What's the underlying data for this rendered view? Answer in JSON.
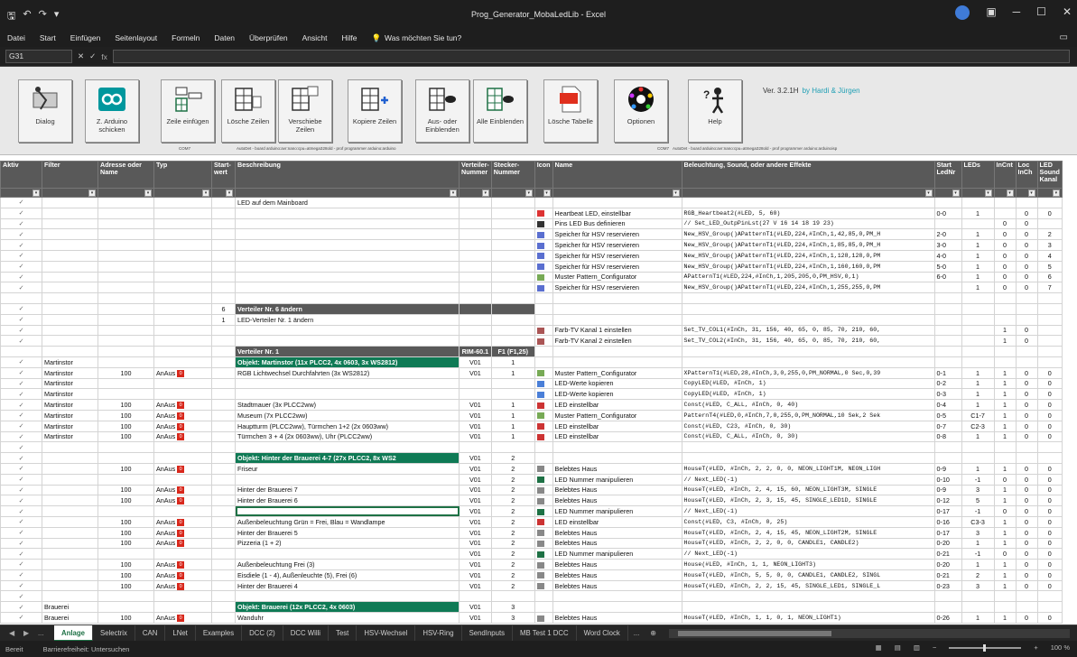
{
  "window": {
    "title": "Prog_Generator_MobaLedLib - Excel",
    "minimize": "─",
    "maximize": "☐",
    "close": "✕"
  },
  "ribbon_tabs": [
    "Datei",
    "Start",
    "Einfügen",
    "Seitenlayout",
    "Formeln",
    "Daten",
    "Überprüfen",
    "Ansicht",
    "Hilfe"
  ],
  "tell_me": "Was möchten Sie tun?",
  "formula_bar": {
    "name_box": "G31",
    "fx": "fx"
  },
  "macro_buttons": [
    {
      "label": "Dialog",
      "icon": "dialog-icon"
    },
    {
      "label": "Z. Arduino schicken",
      "icon": "arduino-icon"
    },
    {
      "label": "Zeile einfügen",
      "icon": "insert-row-icon"
    },
    {
      "label": "Lösche Zeilen",
      "icon": "delete-rows-icon"
    },
    {
      "label": "Verschiebe Zeilen",
      "icon": "move-rows-icon"
    },
    {
      "label": "Kopiere Zeilen",
      "icon": "copy-rows-icon"
    },
    {
      "label": "Aus- oder Einblenden",
      "icon": "hide-show-icon"
    },
    {
      "label": "Alle Einblenden",
      "icon": "show-all-icon"
    },
    {
      "label": "Lösche Tabelle",
      "icon": "delete-table-icon"
    },
    {
      "label": "Optionen",
      "icon": "options-icon"
    },
    {
      "label": "Help",
      "icon": "help-icon"
    }
  ],
  "version": {
    "text": "Ver. 3.2.1H",
    "by": "by Hardi & Jürgen"
  },
  "notes": {
    "com_left": "COM7",
    "com_left_desc": "AutoDet - board arduino:avr:nano:cpu=atmega328old - prof programmer arduino:arduino",
    "com_right": "COM7",
    "com_right_desc": "AutoDet - board arduino:avr:nano:cpu=atmega328old - prof programmer arduino:arduinoisp"
  },
  "columns": [
    "Aktiv",
    "Filter",
    "Adresse oder Name",
    "Typ",
    "Start-wert",
    "Beschreibung",
    "Verteiler-Nummer",
    "Stecker-Nummer",
    "Icon",
    "Name",
    "Beleuchtung, Sound, oder andere Effekte",
    "Start LedNr",
    "LEDs",
    "InCnt",
    "Loc InCh",
    "LED Sound Kanal"
  ],
  "rows": [
    {
      "a": "✓",
      "f": "",
      "adr": "",
      "typ": "",
      "sw": "",
      "desc": "LED auf dem Mainboard",
      "vn": "",
      "sn": "",
      "icon": "",
      "name": "",
      "eff": "",
      "led": "",
      "leds": "",
      "inc": "",
      "loc": "",
      "snd": ""
    },
    {
      "a": "✓",
      "f": "",
      "adr": "",
      "typ": "",
      "sw": "",
      "desc": "",
      "vn": "",
      "sn": "",
      "icon": "heart",
      "name": "Heartbeat LED, einstellbar",
      "eff": "RGB_Heartbeat2(#LED, 5, 60)",
      "led": "0-0",
      "leds": "1",
      "inc": "",
      "loc": "0",
      "snd": "0"
    },
    {
      "a": "✓",
      "f": "",
      "adr": "",
      "typ": "",
      "sw": "",
      "desc": "",
      "vn": "",
      "sn": "",
      "icon": "pin",
      "name": "Pins LED Bus definieren",
      "eff": "// Set_LED_OutpPinLst(27 V 16 14 18 19 23)",
      "led": "",
      "leds": "",
      "inc": "0",
      "loc": "0",
      "snd": ""
    },
    {
      "a": "✓",
      "f": "",
      "adr": "",
      "typ": "",
      "sw": "",
      "desc": "",
      "vn": "",
      "sn": "",
      "icon": "mem",
      "name": "Speicher für HSV reservieren",
      "eff": "New_HSV_Group()APatternT1(#LED,224,#InCh,1,42,85,0,PM_H",
      "led": "2-0",
      "leds": "1",
      "inc": "0",
      "loc": "0",
      "snd": "2"
    },
    {
      "a": "✓",
      "f": "",
      "adr": "",
      "typ": "",
      "sw": "",
      "desc": "",
      "vn": "",
      "sn": "",
      "icon": "mem",
      "name": "Speicher für HSV reservieren",
      "eff": "New_HSV_Group()APatternT1(#LED,224,#InCh,1,85,85,0,PM_H",
      "led": "3-0",
      "leds": "1",
      "inc": "0",
      "loc": "0",
      "snd": "3"
    },
    {
      "a": "✓",
      "f": "",
      "adr": "",
      "typ": "",
      "sw": "",
      "desc": "",
      "vn": "",
      "sn": "",
      "icon": "mem",
      "name": "Speicher für HSV reservieren",
      "eff": "New_HSV_Group()APatternT1(#LED,224,#InCh,1,128,128,0,PM",
      "led": "4-0",
      "leds": "1",
      "inc": "0",
      "loc": "0",
      "snd": "4"
    },
    {
      "a": "✓",
      "f": "",
      "adr": "",
      "typ": "",
      "sw": "",
      "desc": "",
      "vn": "",
      "sn": "",
      "icon": "mem",
      "name": "Speicher für HSV reservieren",
      "eff": "New_HSV_Group()APatternT1(#LED,224,#InCh,1,160,160,0,PM",
      "led": "5-0",
      "leds": "1",
      "inc": "0",
      "loc": "0",
      "snd": "5"
    },
    {
      "a": "✓",
      "f": "",
      "adr": "",
      "typ": "",
      "sw": "",
      "desc": "",
      "vn": "",
      "sn": "",
      "icon": "pat",
      "name": "Muster Pattern_Configurator",
      "eff": "APatternT1(#LED,224,#InCh,1,205,205,0,PM_HSV,0,1)",
      "led": "6-0",
      "leds": "1",
      "inc": "0",
      "loc": "0",
      "snd": "6"
    },
    {
      "a": "✓",
      "f": "",
      "adr": "",
      "typ": "",
      "sw": "",
      "desc": "",
      "vn": "",
      "sn": "",
      "icon": "mem",
      "name": "Speicher für HSV reservieren",
      "eff": "New_HSV_Group()APatternT1(#LED,224,#InCh,1,255,255,0,PM",
      "led": "",
      "leds": "1",
      "inc": "0",
      "loc": "0",
      "snd": "7"
    },
    {
      "a": "",
      "f": "",
      "adr": "",
      "typ": "",
      "sw": "",
      "desc": "",
      "vn": "",
      "sn": "",
      "icon": "",
      "name": "",
      "eff": "",
      "led": "",
      "leds": "",
      "inc": "",
      "loc": "",
      "snd": ""
    },
    {
      "a": "✓",
      "f": "",
      "adr": "",
      "typ": "",
      "sw": "6",
      "desc": "Verteiler Nr. 6 ändern",
      "vn": "",
      "sn": "",
      "icon": "",
      "name": "",
      "eff": "",
      "led": "",
      "leds": "",
      "inc": "",
      "loc": "",
      "snd": "",
      "kind": "verteiler"
    },
    {
      "a": "✓",
      "f": "",
      "adr": "",
      "typ": "",
      "sw": "1",
      "desc": "LED-Verteiler Nr. 1 ändern",
      "vn": "",
      "sn": "",
      "icon": "",
      "name": "",
      "eff": "",
      "led": "",
      "leds": "",
      "inc": "",
      "loc": "",
      "snd": ""
    },
    {
      "a": "✓",
      "f": "",
      "adr": "",
      "typ": "",
      "sw": "",
      "desc": "",
      "vn": "",
      "sn": "",
      "icon": "tv",
      "name": "Farb-TV Kanal 1 einstellen",
      "eff": "Set_TV_COL1(#InCh, 31, 156, 40, 65, 0, 85, 70, 210, 60,",
      "led": "",
      "leds": "",
      "inc": "1",
      "loc": "0",
      "snd": ""
    },
    {
      "a": "✓",
      "f": "",
      "adr": "",
      "typ": "",
      "sw": "",
      "desc": "",
      "vn": "",
      "sn": "",
      "icon": "tv",
      "name": "Farb-TV Kanal 2 einstellen",
      "eff": "Set_TV_COL2(#InCh, 31, 156, 40, 65, 0, 85, 70, 210, 60,",
      "led": "",
      "leds": "",
      "inc": "1",
      "loc": "0",
      "snd": ""
    },
    {
      "a": "",
      "f": "",
      "adr": "",
      "typ": "",
      "sw": "",
      "desc": "Verteiler Nr. 1",
      "vn": "RIM-60.1",
      "sn": "F1 (F1,25)",
      "icon": "",
      "name": "",
      "eff": "",
      "led": "",
      "leds": "",
      "inc": "",
      "loc": "",
      "snd": "",
      "kind": "verteiler"
    },
    {
      "a": "✓",
      "f": "Martinstor",
      "adr": "",
      "typ": "",
      "sw": "",
      "desc": "Objekt: Martinstor (11x PLCC2, 4x 0603, 3x WS2812)",
      "vn": "V01",
      "sn": "1",
      "icon": "",
      "name": "",
      "eff": "",
      "led": "",
      "leds": "",
      "inc": "",
      "loc": "",
      "snd": "",
      "kind": "objekt"
    },
    {
      "a": "✓",
      "f": "Martinstor",
      "adr": "100",
      "typ": "AnAus",
      "sw": "",
      "desc": "RGB Lichtwechsel Durchfahrten (3x WS2812)",
      "vn": "V01",
      "sn": "1",
      "icon": "pat",
      "name": "Muster Pattern_Configurator",
      "eff": "XPatternT1(#LED,28,#InCh,3,0,255,0,PM_NORMAL,0 Sec,0,39",
      "led": "0-1",
      "leds": "1",
      "inc": "1",
      "loc": "0",
      "snd": "0"
    },
    {
      "a": "✓",
      "f": "Martinstor",
      "adr": "",
      "typ": "",
      "sw": "",
      "desc": "",
      "vn": "",
      "sn": "",
      "icon": "copy",
      "name": "LED-Werte kopieren",
      "eff": "CopyLED(#LED, #InCh, 1)",
      "led": "0-2",
      "leds": "1",
      "inc": "1",
      "loc": "0",
      "snd": "0"
    },
    {
      "a": "✓",
      "f": "Martinstor",
      "adr": "",
      "typ": "",
      "sw": "",
      "desc": "",
      "vn": "",
      "sn": "",
      "icon": "copy",
      "name": "LED-Werte kopieren",
      "eff": "CopyLED(#LED, #InCh, 1)",
      "led": "0-3",
      "leds": "1",
      "inc": "1",
      "loc": "0",
      "snd": "0"
    },
    {
      "a": "✓",
      "f": "Martinstor",
      "adr": "100",
      "typ": "AnAus",
      "sw": "",
      "desc": "Stadtmauer (3x PLCC2ww)",
      "vn": "V01",
      "sn": "1",
      "icon": "led",
      "name": "LED einstellbar",
      "eff": "Const(#LED, C_ALL, #InCh, 0, 40)",
      "led": "0-4",
      "leds": "1",
      "inc": "1",
      "loc": "0",
      "snd": "0"
    },
    {
      "a": "✓",
      "f": "Martinstor",
      "adr": "100",
      "typ": "AnAus",
      "sw": "",
      "desc": "Museum (7x PLCC2ww)",
      "vn": "V01",
      "sn": "1",
      "icon": "pat",
      "name": "Muster Pattern_Configurator",
      "eff": "PatternT4(#LED,0,#InCh,7,0,255,0,PM_NORMAL,10 Sek,2 Sek",
      "led": "0-5",
      "leds": "C1-7",
      "inc": "1",
      "loc": "0",
      "snd": "0"
    },
    {
      "a": "✓",
      "f": "Martinstor",
      "adr": "100",
      "typ": "AnAus",
      "sw": "",
      "desc": "Hauptturm (PLCC2ww), Türmchen 1+2 (2x 0603ww)",
      "vn": "V01",
      "sn": "1",
      "icon": "led",
      "name": "LED einstellbar",
      "eff": "Const(#LED, C23, #InCh, 0, 30)",
      "led": "0-7",
      "leds": "C2-3",
      "inc": "1",
      "loc": "0",
      "snd": "0"
    },
    {
      "a": "✓",
      "f": "Martinstor",
      "adr": "100",
      "typ": "AnAus",
      "sw": "",
      "desc": "Türmchen 3 + 4 (2x 0603ww), Uhr (PLCC2ww)",
      "vn": "V01",
      "sn": "1",
      "icon": "led",
      "name": "LED einstellbar",
      "eff": "Const(#LED, C_ALL, #InCh, 0, 30)",
      "led": "0-8",
      "leds": "1",
      "inc": "1",
      "loc": "0",
      "snd": "0"
    },
    {
      "a": "✓",
      "f": "",
      "adr": "",
      "typ": "",
      "sw": "",
      "desc": "",
      "vn": "",
      "sn": "",
      "icon": "",
      "name": "",
      "eff": "",
      "led": "",
      "leds": "",
      "inc": "",
      "loc": "",
      "snd": ""
    },
    {
      "a": "✓",
      "f": "",
      "adr": "",
      "typ": "",
      "sw": "",
      "desc": "Objekt: Hinter der Brauerei 4-7 (27x PLCC2, 8x WS2",
      "vn": "V01",
      "sn": "2",
      "icon": "",
      "name": "",
      "eff": "",
      "led": "",
      "leds": "",
      "inc": "",
      "loc": "",
      "snd": "",
      "kind": "objekt"
    },
    {
      "a": "✓",
      "f": "",
      "adr": "100",
      "typ": "AnAus",
      "sw": "",
      "desc": "Friseur",
      "vn": "V01",
      "sn": "2",
      "icon": "house",
      "name": "Belebtes Haus",
      "eff": "HouseT(#LED, #InCh, 2, 2, 0, 0, NEON_LIGHT1M, NEON_LIGH",
      "led": "0-9",
      "leds": "1",
      "inc": "1",
      "loc": "0",
      "snd": "0"
    },
    {
      "a": "✓",
      "f": "",
      "adr": "",
      "typ": "",
      "sw": "",
      "desc": "",
      "vn": "V01",
      "sn": "2",
      "icon": "num",
      "name": "LED Nummer manipulieren",
      "eff": "// Next_LED(-1)",
      "led": "0-10",
      "leds": "-1",
      "inc": "0",
      "loc": "0",
      "snd": "0"
    },
    {
      "a": "✓",
      "f": "",
      "adr": "100",
      "typ": "AnAus",
      "sw": "",
      "desc": "Hinter der Brauerei 7",
      "vn": "V01",
      "sn": "2",
      "icon": "house",
      "name": "Belebtes Haus",
      "eff": "HouseT(#LED, #InCh, 2, 4, 15, 60, NEON_LIGHT3M, SINGLE",
      "led": "0-9",
      "leds": "3",
      "inc": "1",
      "loc": "0",
      "snd": "0"
    },
    {
      "a": "✓",
      "f": "",
      "adr": "100",
      "typ": "AnAus",
      "sw": "",
      "desc": "Hinter der Brauerei 6",
      "vn": "V01",
      "sn": "2",
      "icon": "house",
      "name": "Belebtes Haus",
      "eff": "HouseT(#LED, #InCh, 2, 3, 15, 45, SINGLE_LED1D, SINGLE",
      "led": "0-12",
      "leds": "5",
      "inc": "1",
      "loc": "0",
      "snd": "0"
    },
    {
      "a": "✓",
      "f": "",
      "adr": "",
      "typ": "",
      "sw": "",
      "desc": "",
      "vn": "V01",
      "sn": "2",
      "icon": "num",
      "name": "LED Nummer manipulieren",
      "eff": "// Next_LED(-1)",
      "led": "0-17",
      "leds": "-1",
      "inc": "0",
      "loc": "0",
      "snd": "0",
      "kind": "selected"
    },
    {
      "a": "✓",
      "f": "",
      "adr": "100",
      "typ": "AnAus",
      "sw": "",
      "desc": "Außenbeleuchtung Grün = Frei, Blau = Wandlampe",
      "vn": "V01",
      "sn": "2",
      "icon": "led",
      "name": "LED einstellbar",
      "eff": "Const(#LED, C3, #InCh, 0, 25)",
      "led": "0-16",
      "leds": "C3-3",
      "inc": "1",
      "loc": "0",
      "snd": "0"
    },
    {
      "a": "✓",
      "f": "",
      "adr": "100",
      "typ": "AnAus",
      "sw": "",
      "desc": "Hinter der Brauerei 5",
      "vn": "V01",
      "sn": "2",
      "icon": "house",
      "name": "Belebtes Haus",
      "eff": "HouseT(#LED, #InCh, 2, 4, 15, 45, NEON_LIGHT2M, SINGLE",
      "led": "0-17",
      "leds": "3",
      "inc": "1",
      "loc": "0",
      "snd": "0"
    },
    {
      "a": "✓",
      "f": "",
      "adr": "100",
      "typ": "AnAus",
      "sw": "",
      "desc": "Pizzeria (1 + 2)",
      "vn": "V01",
      "sn": "2",
      "icon": "house",
      "name": "Belebtes Haus",
      "eff": "HouseT(#LED, #InCh, 2, 2, 0, 0, CANDLE1, CANDLE2)",
      "led": "0-20",
      "leds": "1",
      "inc": "1",
      "loc": "0",
      "snd": "0"
    },
    {
      "a": "✓",
      "f": "",
      "adr": "",
      "typ": "",
      "sw": "",
      "desc": "",
      "vn": "V01",
      "sn": "2",
      "icon": "num",
      "name": "LED Nummer manipulieren",
      "eff": "// Next_LED(-1)",
      "led": "0-21",
      "leds": "-1",
      "inc": "0",
      "loc": "0",
      "snd": "0"
    },
    {
      "a": "✓",
      "f": "",
      "adr": "100",
      "typ": "AnAus",
      "sw": "",
      "desc": "Außenbeleuchtung Frei (3)",
      "vn": "V01",
      "sn": "2",
      "icon": "house",
      "name": "Belebtes Haus",
      "eff": "House(#LED, #InCh, 1, 1, NEON_LIGHT3)",
      "led": "0-20",
      "leds": "1",
      "inc": "1",
      "loc": "0",
      "snd": "0"
    },
    {
      "a": "✓",
      "f": "",
      "adr": "100",
      "typ": "AnAus",
      "sw": "",
      "desc": "Eisdiele (1 - 4), Außenleuchte (5), Frei (6)",
      "vn": "V01",
      "sn": "2",
      "icon": "house",
      "name": "Belebtes Haus",
      "eff": "HouseT(#LED, #InCh, 5, 5, 0, 0, CANDLE1, CANDLE2, SINGL",
      "led": "0-21",
      "leds": "2",
      "inc": "1",
      "loc": "0",
      "snd": "0"
    },
    {
      "a": "✓",
      "f": "",
      "adr": "100",
      "typ": "AnAus",
      "sw": "",
      "desc": "Hinter der Brauerei 4",
      "vn": "V01",
      "sn": "2",
      "icon": "house",
      "name": "Belebtes Haus",
      "eff": "HouseT(#LED, #InCh, 2, 2, 15, 45, SINGLE_LED1, SINGLE_L",
      "led": "0-23",
      "leds": "3",
      "inc": "1",
      "loc": "0",
      "snd": "0"
    },
    {
      "a": "✓",
      "f": "",
      "adr": "",
      "typ": "",
      "sw": "",
      "desc": "",
      "vn": "",
      "sn": "",
      "icon": "",
      "name": "",
      "eff": "",
      "led": "",
      "leds": "",
      "inc": "",
      "loc": "",
      "snd": ""
    },
    {
      "a": "✓",
      "f": "Brauerei",
      "adr": "",
      "typ": "",
      "sw": "",
      "desc": "Objekt: Brauerei (12x PLCC2, 4x 0603)",
      "vn": "V01",
      "sn": "3",
      "icon": "",
      "name": "",
      "eff": "",
      "led": "",
      "leds": "",
      "inc": "",
      "loc": "",
      "snd": "",
      "kind": "objekt"
    },
    {
      "a": "✓",
      "f": "Brauerei",
      "adr": "100",
      "typ": "AnAus",
      "sw": "",
      "desc": "Wanduhr",
      "vn": "V01",
      "sn": "3",
      "icon": "house",
      "name": "Belebtes Haus",
      "eff": "HouseT(#LED, #InCh, 1, 1, 0, 1, NEON_LIGHT1)",
      "led": "0-26",
      "leds": "1",
      "inc": "1",
      "loc": "0",
      "snd": "0"
    }
  ],
  "sheet_tabs": [
    "Anlage",
    "Selectrix",
    "CAN",
    "LNet",
    "Examples",
    "DCC (2)",
    "DCC Willi",
    "Test",
    "HSV-Wechsel",
    "HSV-Ring",
    "SendInputs",
    "MB Test 1 DCC",
    "Word Clock"
  ],
  "active_tab": "Anlage",
  "tab_more": "...",
  "status": {
    "ready": "Bereit",
    "accessibility": "Barrierefreiheit: Untersuchen",
    "zoom": "100 %"
  }
}
